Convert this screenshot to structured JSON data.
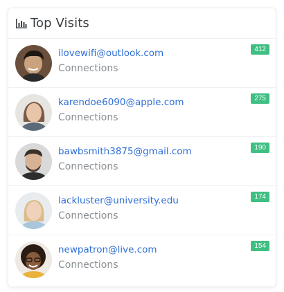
{
  "card": {
    "title": "Top Visits",
    "icon": "bar-chart-icon"
  },
  "visits": [
    {
      "email": "ilovewifi@outlook.com",
      "label": "Connections",
      "count": "412",
      "avatar": "avatar-1"
    },
    {
      "email": "karendoe6090@apple.com",
      "label": "Connections",
      "count": "275",
      "avatar": "avatar-2"
    },
    {
      "email": "bawbsmith3875@gmail.com",
      "label": "Connections",
      "count": "190",
      "avatar": "avatar-3"
    },
    {
      "email": "lackluster@university.edu",
      "label": "Connections",
      "count": "174",
      "avatar": "avatar-4"
    },
    {
      "email": "newpatron@live.com",
      "label": "Connections",
      "count": "154",
      "avatar": "avatar-5"
    }
  ],
  "colors": {
    "link": "#2f6fd6",
    "badge": "#3fbf82",
    "muted": "#8a8f94"
  }
}
